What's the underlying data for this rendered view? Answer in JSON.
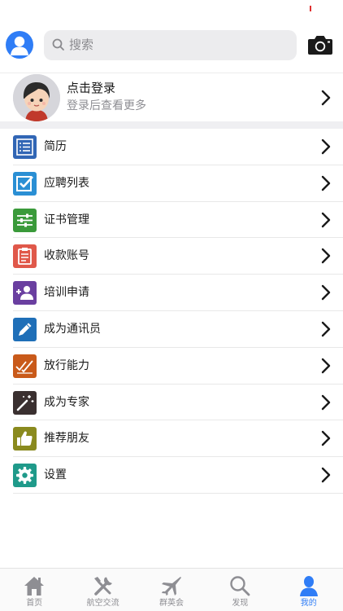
{
  "search": {
    "placeholder": "搜索"
  },
  "profile": {
    "title": "点击登录",
    "subtitle": "登录后查看更多"
  },
  "menu": [
    {
      "label": "简历",
      "icon": "resume-list-icon",
      "color": "#3166b5"
    },
    {
      "label": "应聘列表",
      "icon": "checkbox-icon",
      "color": "#2a8fd4"
    },
    {
      "label": "证书管理",
      "icon": "sliders-icon",
      "color": "#3a9a3a"
    },
    {
      "label": "收款账号",
      "icon": "clipboard-icon",
      "color": "#e0584a"
    },
    {
      "label": "培训申请",
      "icon": "add-user-icon",
      "color": "#6a3fa0"
    },
    {
      "label": "成为通讯员",
      "icon": "pencil-icon",
      "color": "#1f6fb8"
    },
    {
      "label": "放行能力",
      "icon": "double-check-icon",
      "color": "#c95a1a"
    },
    {
      "label": "成为专家",
      "icon": "magic-wand-icon",
      "color": "#3a3030"
    },
    {
      "label": "推荐朋友",
      "icon": "thumbs-up-icon",
      "color": "#8a8a1e"
    },
    {
      "label": "设置",
      "icon": "gear-icon",
      "color": "#1f9a8a"
    }
  ],
  "tabs": [
    {
      "label": "首页",
      "icon": "home-icon",
      "active": false
    },
    {
      "label": "航空交流",
      "icon": "tools-icon",
      "active": false
    },
    {
      "label": "群英会",
      "icon": "jet-icon",
      "active": false
    },
    {
      "label": "发现",
      "icon": "magnifier-icon",
      "active": false
    },
    {
      "label": "我的",
      "icon": "person-icon",
      "active": true
    }
  ],
  "colors": {
    "accent": "#2f7df6",
    "inactive_tab": "#8e8e93"
  }
}
